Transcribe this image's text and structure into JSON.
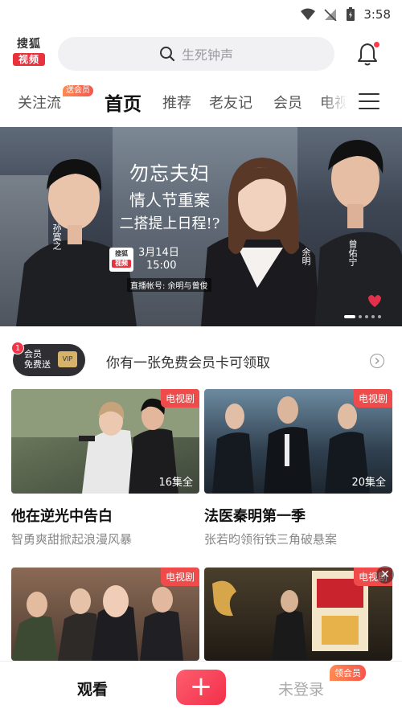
{
  "status_bar": {
    "time": "3:58",
    "icons": [
      "wifi-icon",
      "signal-icon",
      "battery-icon"
    ]
  },
  "header": {
    "logo_line1": "搜狐",
    "logo_line2": "视频",
    "search_placeholder": "生死钟声"
  },
  "tabs": [
    {
      "label": "关注流",
      "badge": "送会员"
    },
    {
      "label": "首页",
      "active": true
    },
    {
      "label": "推荐"
    },
    {
      "label": "老友记"
    },
    {
      "label": "会员"
    },
    {
      "label": "电视"
    }
  ],
  "banner": {
    "title_line1": "勿忘夫妇",
    "title_line2": "情人节重案",
    "title_line3": "二搭提上日程!?",
    "date": "3月14日",
    "time": "15:00",
    "logo_line1": "搜狐",
    "logo_line2": "视频",
    "subtitle": "直播帐号: 余明与曾俊",
    "name_left": "孙寞之",
    "name_mid": "余明",
    "name_right": "曾佑宁"
  },
  "member_bar": {
    "count": "1",
    "card_line1": "会员",
    "card_line2": "免费送",
    "card_vip": "VIP",
    "text": "你有一张免费会员卡可领取"
  },
  "cards": [
    {
      "tag": "电视剧",
      "episodes": "16集全",
      "title": "他在逆光中告白",
      "desc": "智勇爽甜掀起浪漫风暴"
    },
    {
      "tag": "电视剧",
      "episodes": "20集全",
      "title": "法医秦明第一季",
      "desc": "张若昀领衔铁三角破悬案"
    },
    {
      "tag": "电视剧",
      "episodes": "",
      "title": "",
      "desc": ""
    },
    {
      "tag": "电视剧",
      "episodes": "",
      "title": "",
      "desc": ""
    }
  ],
  "bottom_nav": {
    "watch": "观看",
    "plus": "+",
    "login": "未登录",
    "login_badge": "领会员"
  },
  "ad_close": "✕"
}
